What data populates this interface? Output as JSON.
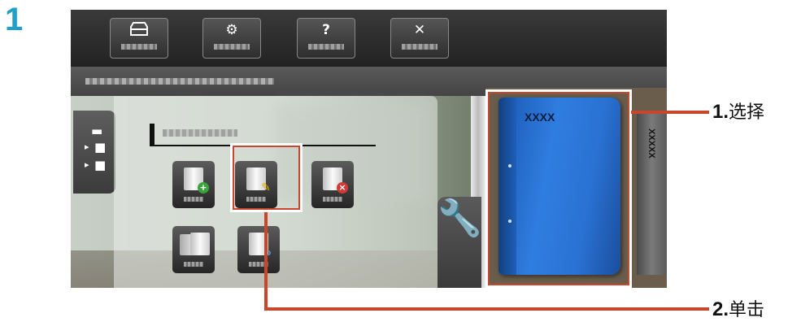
{
  "step_number": "1",
  "toolbar": {
    "buttons": [
      {
        "name": "inbox",
        "icon": "tray-icon"
      },
      {
        "name": "settings",
        "icon": "gear-icon"
      },
      {
        "name": "help",
        "icon": "question-icon",
        "glyph": "?"
      },
      {
        "name": "close",
        "icon": "close-icon",
        "glyph": "✕"
      }
    ]
  },
  "book": {
    "title": "XXXX",
    "spine_title": "XXXXX"
  },
  "callouts": {
    "one": {
      "num": "1.",
      "text": "选择"
    },
    "two": {
      "num": "2.",
      "text": "单击"
    }
  },
  "colors": {
    "highlight": "#c8472c",
    "step_number": "#1ea0c8",
    "book_blue": "#2f7de0"
  }
}
